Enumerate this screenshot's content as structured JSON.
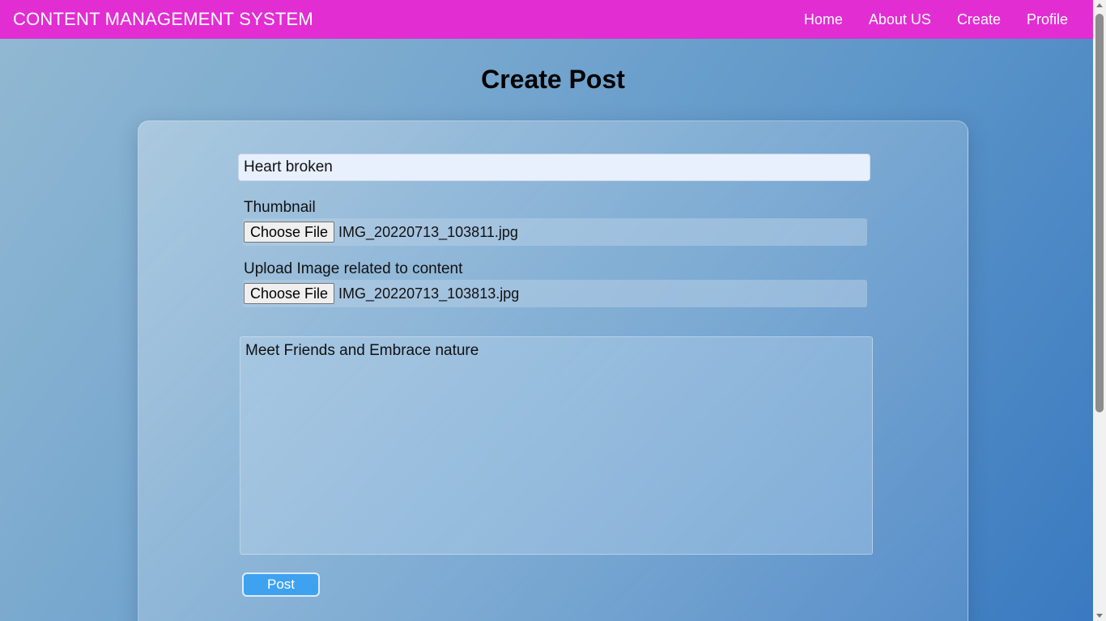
{
  "navbar": {
    "brand": "CONTENT MANAGEMENT SYSTEM",
    "links": [
      "Home",
      "About US",
      "Create",
      "Profile"
    ],
    "background_color": "#e22dd3"
  },
  "page": {
    "title": "Create Post"
  },
  "form": {
    "title_value": "Heart broken",
    "thumbnail": {
      "label": "Thumbnail",
      "button": "Choose File",
      "file_name": "IMG_20220713_103811.jpg"
    },
    "content_image": {
      "label": "Upload Image related to content",
      "button": "Choose File",
      "file_name": "IMG_20220713_103813.jpg"
    },
    "content_value": "Meet Friends and Embrace nature",
    "submit_label": "Post",
    "submit_color": "#3fa2f0"
  }
}
